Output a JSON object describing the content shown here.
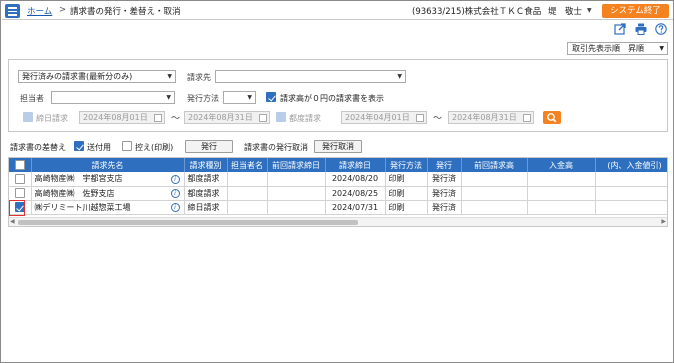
{
  "header": {
    "home_link": "ホーム",
    "separator": ">",
    "page_title": "請求書の発行・差替え・取消",
    "company": "(93633/215)株式会社ＴＫＣ食品",
    "user": "堤　敬士",
    "logout_label": "システム終了"
  },
  "toolbar": {
    "export_icon": "export-icon",
    "print_icon": "print-icon",
    "help_icon": "help-icon"
  },
  "sort": {
    "value": "取引先表示順　昇順"
  },
  "filters": {
    "invoice_type": "発行済みの請求書(最新分のみ)",
    "billing_to_label": "請求先",
    "billing_to_value": "",
    "staff_label": "担当者",
    "staff_value": "",
    "method_label": "発行方法",
    "method_value": "",
    "zero_amount_label": "請求高が０円の請求書を表示",
    "zero_amount_checked": true,
    "closing_label": "締日請求",
    "closing_from": "2024年08月01日",
    "closing_to": "2024年08月31日",
    "each_label": "都度請求",
    "each_from": "2024年04月01日",
    "each_to": "2024年08月31日",
    "tilde": "～"
  },
  "actions": {
    "replace_label": "請求書の差替え",
    "attach_label": "送付用",
    "attach_checked": true,
    "copy_label": "控え(印刷)",
    "copy_checked": false,
    "issue_button": "発行",
    "cancel_label": "請求書の発行取消",
    "cancel_button": "発行取消"
  },
  "table": {
    "columns": [
      "",
      "請求先名",
      "請求種別",
      "担当者名",
      "前回請求締日",
      "請求締日",
      "発行方法",
      "発行",
      "前回請求高",
      "入金高",
      "(内、入金値引)"
    ],
    "rows": [
      {
        "checked": false,
        "name": "高崎物産㈱　宇都宮支店",
        "type": "都度請求",
        "staff": "",
        "prev_close": "",
        "close": "2024/08/20",
        "method": "印刷",
        "issued": "発行済",
        "prev_amount": "",
        "paid": "",
        "discount": ""
      },
      {
        "checked": false,
        "name": "高崎物産㈱　佐野支店",
        "type": "都度請求",
        "staff": "",
        "prev_close": "",
        "close": "2024/08/25",
        "method": "印刷",
        "issued": "発行済",
        "prev_amount": "",
        "paid": "",
        "discount": ""
      },
      {
        "checked": true,
        "name": "㈱デリミート川越惣菜工場",
        "type": "締日請求",
        "staff": "",
        "prev_close": "",
        "close": "2024/07/31",
        "method": "印刷",
        "issued": "発行済",
        "prev_amount": "",
        "paid": "",
        "discount": ""
      }
    ]
  },
  "colors": {
    "accent": "#2e6fbf",
    "orange": "#f58220",
    "highlight": "#e23030"
  }
}
